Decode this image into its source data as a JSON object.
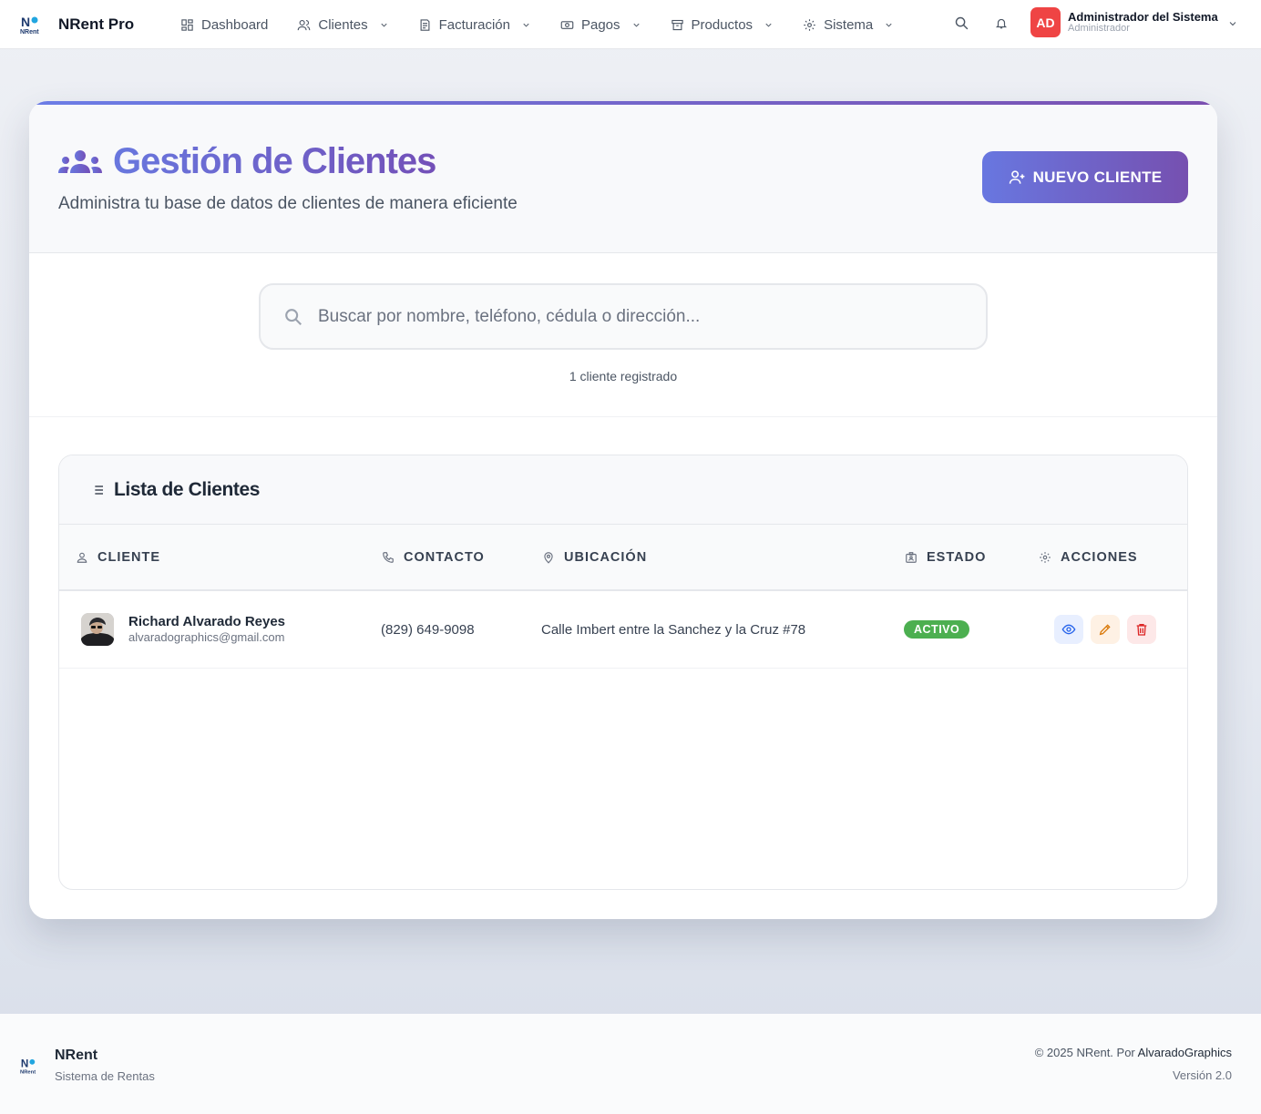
{
  "brand": {
    "name": "NRent Pro"
  },
  "nav": [
    {
      "label": "Dashboard",
      "icon": "dashboard-icon",
      "dropdown": false
    },
    {
      "label": "Clientes",
      "icon": "users-icon",
      "dropdown": true
    },
    {
      "label": "Facturación",
      "icon": "invoice-icon",
      "dropdown": true
    },
    {
      "label": "Pagos",
      "icon": "money-icon",
      "dropdown": true
    },
    {
      "label": "Productos",
      "icon": "box-icon",
      "dropdown": true
    },
    {
      "label": "Sistema",
      "icon": "gear-icon",
      "dropdown": true
    }
  ],
  "user": {
    "initials": "AD",
    "name": "Administrador del Sistema",
    "role": "Administrador",
    "avatar_color": "#ef4444"
  },
  "header": {
    "title": "Gestión de Clientes",
    "subtitle": "Administra tu base de datos de clientes de manera eficiente",
    "new_button": "NUEVO CLIENTE"
  },
  "search": {
    "placeholder": "Buscar por nombre, teléfono, cédula o dirección...",
    "value": "",
    "count_text": "1 cliente registrado"
  },
  "list": {
    "title": "Lista de Clientes",
    "columns": [
      "CLIENTE",
      "CONTACTO",
      "UBICACIÓN",
      "ESTADO",
      "ACCIONES"
    ],
    "rows": [
      {
        "name": "Richard Alvarado Reyes",
        "email": "alvaradographics@gmail.com",
        "phone": "(829) 649-9098",
        "address": "Calle Imbert entre la Sanchez y la Cruz #78",
        "status": "ACTIVO"
      }
    ]
  },
  "footer": {
    "name": "NRent",
    "subtitle": "Sistema de Rentas",
    "copyright": "© 2025 NRent. Por",
    "author": "AlvaradoGraphics",
    "version": "Versión 2.0"
  },
  "colors": {
    "accent_start": "#6877de",
    "accent_end": "#7350b8",
    "status_active": "#4caf50"
  }
}
